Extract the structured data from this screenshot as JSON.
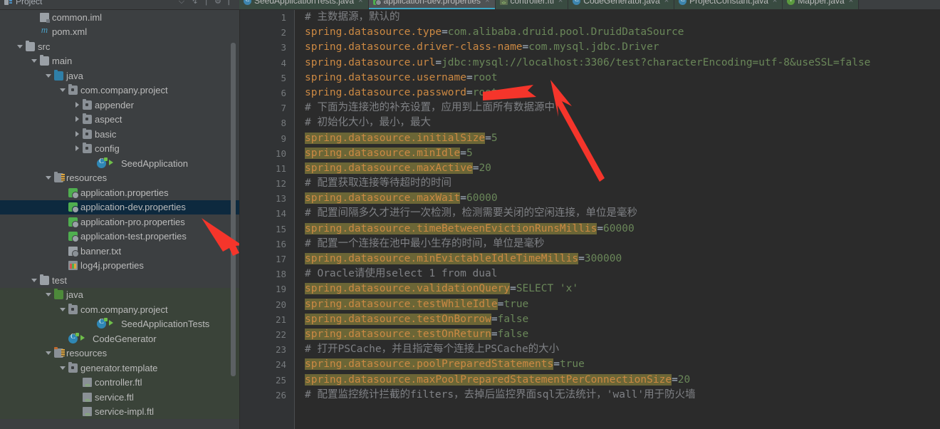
{
  "window": {
    "project_panel_title": "Project",
    "accent_tab_underline": "#3ba6c4",
    "selection_color": "#0d293e",
    "highlight_color": "#6b6636",
    "arrow_color": "#f5352b"
  },
  "toolwindow_icons": [
    "collapse-all-icon",
    "locate-icon",
    "settings-icon",
    "hide-icon"
  ],
  "tabs": [
    {
      "label": "SeedApplicationTests.java",
      "icon": "java-class-icon",
      "active": false,
      "close": "×"
    },
    {
      "label": "application-dev.properties",
      "icon": "properties-file-icon",
      "active": true,
      "close": "×"
    },
    {
      "label": "controller.ftl",
      "icon": "ftl-file-icon",
      "active": false,
      "close": "×"
    },
    {
      "label": "CodeGenerator.java",
      "icon": "java-class-icon",
      "active": false,
      "close": "×"
    },
    {
      "label": "ProjectConstant.java",
      "icon": "java-class-icon",
      "active": false,
      "close": "×"
    },
    {
      "label": "Mapper.java",
      "icon": "java-interface-icon",
      "active": false,
      "close": "×"
    }
  ],
  "tree": [
    {
      "label": "common.iml",
      "indent": 2,
      "arrow": "none",
      "icon": "iml-file-icon",
      "state": "normal"
    },
    {
      "label": "pom.xml",
      "indent": 2,
      "arrow": "none",
      "icon": "maven-pom-icon",
      "state": "normal"
    },
    {
      "label": "src",
      "indent": 1,
      "arrow": "down",
      "icon": "folder-grey-icon",
      "state": "normal"
    },
    {
      "label": "main",
      "indent": 2,
      "arrow": "down",
      "icon": "folder-grey-icon",
      "state": "normal"
    },
    {
      "label": "java",
      "indent": 3,
      "arrow": "down",
      "icon": "folder-source-blue-icon",
      "state": "normal"
    },
    {
      "label": "com.company.project",
      "indent": 4,
      "arrow": "down",
      "icon": "package-icon",
      "state": "normal"
    },
    {
      "label": "appender",
      "indent": 5,
      "arrow": "right",
      "icon": "package-icon",
      "state": "normal"
    },
    {
      "label": "aspect",
      "indent": 5,
      "arrow": "right",
      "icon": "package-icon",
      "state": "normal"
    },
    {
      "label": "basic",
      "indent": 5,
      "arrow": "right",
      "icon": "package-icon",
      "state": "normal"
    },
    {
      "label": "config",
      "indent": 5,
      "arrow": "right",
      "icon": "package-icon",
      "state": "normal"
    },
    {
      "label": "SeedApplication",
      "indent": 6,
      "arrow": "none",
      "icon": "java-runnable-class-icon",
      "state": "normal"
    },
    {
      "label": "resources",
      "indent": 3,
      "arrow": "down",
      "icon": "folder-resources-icon",
      "state": "normal"
    },
    {
      "label": "application.properties",
      "indent": 4,
      "arrow": "none",
      "icon": "properties-file-icon",
      "state": "normal"
    },
    {
      "label": "application-dev.properties",
      "indent": 4,
      "arrow": "none",
      "icon": "properties-file-icon",
      "state": "selected"
    },
    {
      "label": "application-pro.properties",
      "indent": 4,
      "arrow": "none",
      "icon": "properties-file-icon",
      "state": "normal"
    },
    {
      "label": "application-test.properties",
      "indent": 4,
      "arrow": "none",
      "icon": "properties-file-icon",
      "state": "normal"
    },
    {
      "label": "banner.txt",
      "indent": 4,
      "arrow": "none",
      "icon": "text-file-icon",
      "state": "normal"
    },
    {
      "label": "log4j.properties",
      "indent": 4,
      "arrow": "none",
      "icon": "log4j-file-icon",
      "state": "normal"
    },
    {
      "label": "test",
      "indent": 2,
      "arrow": "down",
      "icon": "folder-grey-icon",
      "state": "normal"
    },
    {
      "label": "java",
      "indent": 3,
      "arrow": "down",
      "icon": "folder-test-green-icon",
      "state": "testroot"
    },
    {
      "label": "com.company.project",
      "indent": 4,
      "arrow": "down",
      "icon": "package-icon",
      "state": "testroot"
    },
    {
      "label": "SeedApplicationTests",
      "indent": 6,
      "arrow": "none",
      "icon": "java-runnable-class-icon",
      "state": "testroot"
    },
    {
      "label": "CodeGenerator",
      "indent": 4,
      "arrow": "none",
      "icon": "java-runnable-class-icon",
      "state": "testroot"
    },
    {
      "label": "resources",
      "indent": 3,
      "arrow": "down",
      "icon": "folder-test-resources-icon",
      "state": "testroot"
    },
    {
      "label": "generator.template",
      "indent": 4,
      "arrow": "down",
      "icon": "package-icon",
      "state": "testroot"
    },
    {
      "label": "controller.ftl",
      "indent": 5,
      "arrow": "none",
      "icon": "ftl-file-icon",
      "state": "testroot"
    },
    {
      "label": "service.ftl",
      "indent": 5,
      "arrow": "none",
      "icon": "ftl-file-icon",
      "state": "testroot"
    },
    {
      "label": "service-impl.ftl",
      "indent": 5,
      "arrow": "none",
      "icon": "ftl-file-icon",
      "state": "testroot"
    }
  ],
  "editor": {
    "lines": [
      {
        "n": 1,
        "parts": [
          {
            "t": "# 主数据源，默认的",
            "c": "cm"
          }
        ]
      },
      {
        "n": 2,
        "parts": [
          {
            "t": "spring.datasource.type",
            "c": "ck"
          },
          {
            "t": "=",
            "c": "ceq"
          },
          {
            "t": "com.alibaba.druid.pool.DruidDataSource",
            "c": "cv"
          }
        ]
      },
      {
        "n": 3,
        "parts": [
          {
            "t": "spring.datasource.driver-class-name",
            "c": "ck"
          },
          {
            "t": "=",
            "c": "ceq"
          },
          {
            "t": "com.mysql.jdbc.Driver",
            "c": "cv"
          }
        ]
      },
      {
        "n": 4,
        "parts": [
          {
            "t": "spring.datasource.url",
            "c": "ck"
          },
          {
            "t": "=",
            "c": "ceq"
          },
          {
            "t": "jdbc:mysql://localhost:3306/test?characterEncoding=utf-8&useSSL=false",
            "c": "cv"
          }
        ]
      },
      {
        "n": 5,
        "parts": [
          {
            "t": "spring.datasource.username",
            "c": "ck"
          },
          {
            "t": "=",
            "c": "ceq"
          },
          {
            "t": "root",
            "c": "cv"
          }
        ]
      },
      {
        "n": 6,
        "parts": [
          {
            "t": "spring.datasource.password",
            "c": "ck"
          },
          {
            "t": "=",
            "c": "ceq"
          },
          {
            "t": "root",
            "c": "cv"
          }
        ]
      },
      {
        "n": 7,
        "parts": [
          {
            "t": "# 下面为连接池的补充设置，应用到上面所有数据源中",
            "c": "cm"
          }
        ]
      },
      {
        "n": 8,
        "parts": [
          {
            "t": "# 初始化大小，最小，最大",
            "c": "cm"
          }
        ]
      },
      {
        "n": 9,
        "parts": [
          {
            "t": "spring.datasource.initialSize",
            "c": "ck",
            "hl": true
          },
          {
            "t": "=",
            "c": "ceq"
          },
          {
            "t": "5",
            "c": "cv"
          }
        ]
      },
      {
        "n": 10,
        "parts": [
          {
            "t": "spring.datasource.minIdle",
            "c": "ck",
            "hl": true
          },
          {
            "t": "=",
            "c": "ceq"
          },
          {
            "t": "5",
            "c": "cv"
          }
        ]
      },
      {
        "n": 11,
        "parts": [
          {
            "t": "spring.datasource.maxActive",
            "c": "ck",
            "hl": true
          },
          {
            "t": "=",
            "c": "ceq"
          },
          {
            "t": "20",
            "c": "cv"
          }
        ]
      },
      {
        "n": 12,
        "parts": [
          {
            "t": "# 配置获取连接等待超时的时间",
            "c": "cm"
          }
        ]
      },
      {
        "n": 13,
        "parts": [
          {
            "t": "spring.datasource.maxWait",
            "c": "ck",
            "hl": true
          },
          {
            "t": "=",
            "c": "ceq"
          },
          {
            "t": "60000",
            "c": "cv"
          }
        ]
      },
      {
        "n": 14,
        "parts": [
          {
            "t": "# 配置间隔多久才进行一次检测，检测需要关闭的空闲连接，单位是毫秒",
            "c": "cm"
          }
        ]
      },
      {
        "n": 15,
        "parts": [
          {
            "t": "spring.datasource.timeBetweenEvictionRunsMillis",
            "c": "ck",
            "hl": true
          },
          {
            "t": "=",
            "c": "ceq"
          },
          {
            "t": "60000",
            "c": "cv"
          }
        ]
      },
      {
        "n": 16,
        "parts": [
          {
            "t": "# 配置一个连接在池中最小生存的时间，单位是毫秒",
            "c": "cm"
          }
        ]
      },
      {
        "n": 17,
        "parts": [
          {
            "t": "spring.datasource.minEvictableIdleTimeMillis",
            "c": "ck",
            "hl": true
          },
          {
            "t": "=",
            "c": "ceq"
          },
          {
            "t": "300000",
            "c": "cv"
          }
        ]
      },
      {
        "n": 18,
        "parts": [
          {
            "t": "# Oracle请使用select 1 from dual",
            "c": "cm"
          }
        ]
      },
      {
        "n": 19,
        "parts": [
          {
            "t": "spring.datasource.validationQuery",
            "c": "ck",
            "hl": true
          },
          {
            "t": "=",
            "c": "ceq"
          },
          {
            "t": "SELECT 'x'",
            "c": "cv"
          }
        ]
      },
      {
        "n": 20,
        "parts": [
          {
            "t": "spring.datasource.testWhileIdle",
            "c": "ck",
            "hl": true
          },
          {
            "t": "=",
            "c": "ceq"
          },
          {
            "t": "true",
            "c": "cv"
          }
        ]
      },
      {
        "n": 21,
        "parts": [
          {
            "t": "spring.datasource.testOnBorrow",
            "c": "ck",
            "hl": true
          },
          {
            "t": "=",
            "c": "ceq"
          },
          {
            "t": "false",
            "c": "cv"
          }
        ]
      },
      {
        "n": 22,
        "parts": [
          {
            "t": "spring.datasource.testOnReturn",
            "c": "ck",
            "hl": true
          },
          {
            "t": "=",
            "c": "ceq"
          },
          {
            "t": "false",
            "c": "cv"
          }
        ]
      },
      {
        "n": 23,
        "parts": [
          {
            "t": "# 打开PSCache，并且指定每个连接上PSCache的大小",
            "c": "cm"
          }
        ]
      },
      {
        "n": 24,
        "parts": [
          {
            "t": "spring.datasource.poolPreparedStatements",
            "c": "ck",
            "hl": true
          },
          {
            "t": "=",
            "c": "ceq"
          },
          {
            "t": "true",
            "c": "cv"
          }
        ]
      },
      {
        "n": 25,
        "parts": [
          {
            "t": "spring.datasource.maxPoolPreparedStatementPerConnectionSize",
            "c": "ck",
            "hl": true
          },
          {
            "t": "=",
            "c": "ceq"
          },
          {
            "t": "20",
            "c": "cv"
          }
        ]
      },
      {
        "n": 26,
        "parts": [
          {
            "t": "# 配置监控统计拦截的filters，去掉后监控界面sql无法统计，'wall'用于防火墙",
            "c": "cm"
          }
        ]
      }
    ]
  }
}
